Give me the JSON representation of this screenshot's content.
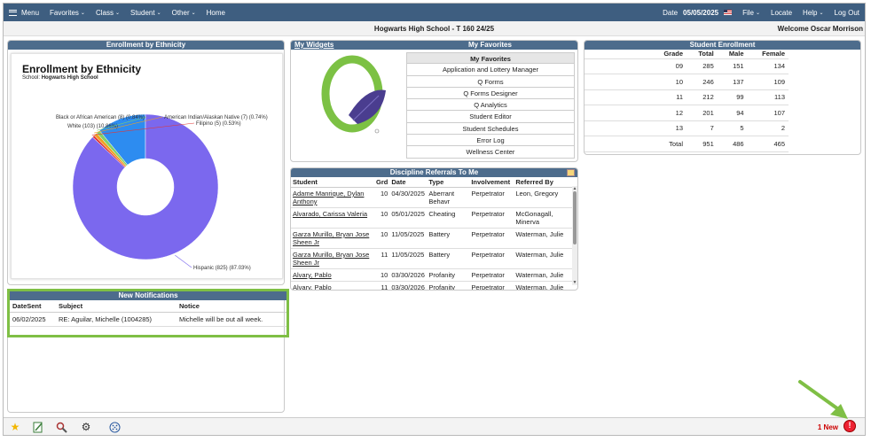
{
  "nav": {
    "menu": "Menu",
    "items": [
      "Favorites",
      "Class",
      "Student",
      "Other"
    ],
    "home": "Home",
    "date_label": "Date",
    "date_value": "05/05/2025",
    "file": "File",
    "locate": "Locate",
    "help": "Help",
    "logout": "Log Out"
  },
  "header": {
    "school": "Hogwarts High School - T 160 24/25",
    "welcome": "Welcome Oscar Morrison"
  },
  "ethnicity": {
    "panel_title": "Enrollment by Ethnicity",
    "title": "Enrollment by Ethnicity",
    "subtitle_prefix": "School:",
    "subtitle_school": "Hogwarts High School"
  },
  "chart_data": {
    "type": "pie",
    "title": "Enrollment by Ethnicity",
    "slices": [
      {
        "label": "Hispanic (825) (87.03%)",
        "value": 825,
        "percent": 87.03,
        "color": "#7b68ee"
      },
      {
        "label": "White (103) (10.86%)",
        "value": 103,
        "percent": 10.86,
        "color": "#2d8cf0"
      },
      {
        "label": "Black or African American (8) (0.84%)",
        "value": 8,
        "percent": 0.84,
        "color": "#7fd06e"
      },
      {
        "label": "American Indian/Alaskan Native (7) (0.74%)",
        "value": 7,
        "percent": 0.74,
        "color": "#f0a020"
      },
      {
        "label": "Filipino (5) (0.53%)",
        "value": 5,
        "percent": 0.53,
        "color": "#e03838"
      }
    ]
  },
  "notifications": {
    "title": "New Notifications",
    "columns": [
      "DateSent",
      "Subject",
      "Notice"
    ],
    "rows": [
      {
        "date": "06/02/2025",
        "subject": "RE: Aguilar, Michelle (1004285)",
        "notice": "Michelle will be out all week."
      }
    ]
  },
  "favorites": {
    "widgets_label": "My Widgets",
    "title": "My Favorites",
    "list_header": "My Favorites",
    "items": [
      "Application and Lottery Manager",
      "Q Forms",
      "Q Forms Designer",
      "Q Analytics",
      "Student Editor",
      "Student Schedules",
      "Error Log",
      "Wellness Center"
    ]
  },
  "discipline": {
    "title": "Discipline Referrals To Me",
    "columns": [
      "Student",
      "Grd",
      "Date",
      "Type",
      "Involvement",
      "Referred By"
    ],
    "rows": [
      {
        "student": "Adame Manrique, Dylan Anthony",
        "grd": "10",
        "date": "04/30/2025",
        "type": "Aberrant Behavr",
        "involvement": "Perpetrator",
        "ref": "Leon, Gregory"
      },
      {
        "student": "Alvarado, Carissa Valeria",
        "grd": "10",
        "date": "05/01/2025",
        "type": "Cheating",
        "involvement": "Perpetrator",
        "ref": "McGonagall, Minerva"
      },
      {
        "student": "Garza Murillo, Bryan Jose Sheen Jr",
        "grd": "10",
        "date": "11/05/2025",
        "type": "Battery",
        "involvement": "Perpetrator",
        "ref": "Waterman, Julie"
      },
      {
        "student": "Garza Murillo, Bryan Jose Sheen Jr",
        "grd": "11",
        "date": "11/05/2025",
        "type": "Battery",
        "involvement": "Perpetrator",
        "ref": "Waterman, Julie"
      },
      {
        "student": "Alvary, Pablo",
        "grd": "10",
        "date": "03/30/2026",
        "type": "Profanity",
        "involvement": "Perpetrator",
        "ref": "Waterman, Julie"
      },
      {
        "student": "Alvary, Pablo",
        "grd": "11",
        "date": "03/30/2026",
        "type": "Profanity",
        "involvement": "Perpetrator",
        "ref": "Waterman, Julie"
      }
    ]
  },
  "enrollment": {
    "title": "Student Enrollment",
    "columns": [
      "Grade",
      "Total",
      "Male",
      "Female"
    ],
    "rows": [
      [
        "09",
        "285",
        "151",
        "134"
      ],
      [
        "10",
        "246",
        "137",
        "109"
      ],
      [
        "11",
        "212",
        "99",
        "113"
      ],
      [
        "12",
        "201",
        "94",
        "107"
      ],
      [
        "13",
        "7",
        "5",
        "2"
      ],
      [
        "Total",
        "951",
        "486",
        "465"
      ]
    ]
  },
  "bottom": {
    "new_count": "1 New",
    "alert_glyph": "!"
  },
  "colors": {
    "nav": "#3e5e80",
    "panel_header": "#4d6c8c",
    "highlight": "#7fbf45",
    "alert": "#e23"
  }
}
